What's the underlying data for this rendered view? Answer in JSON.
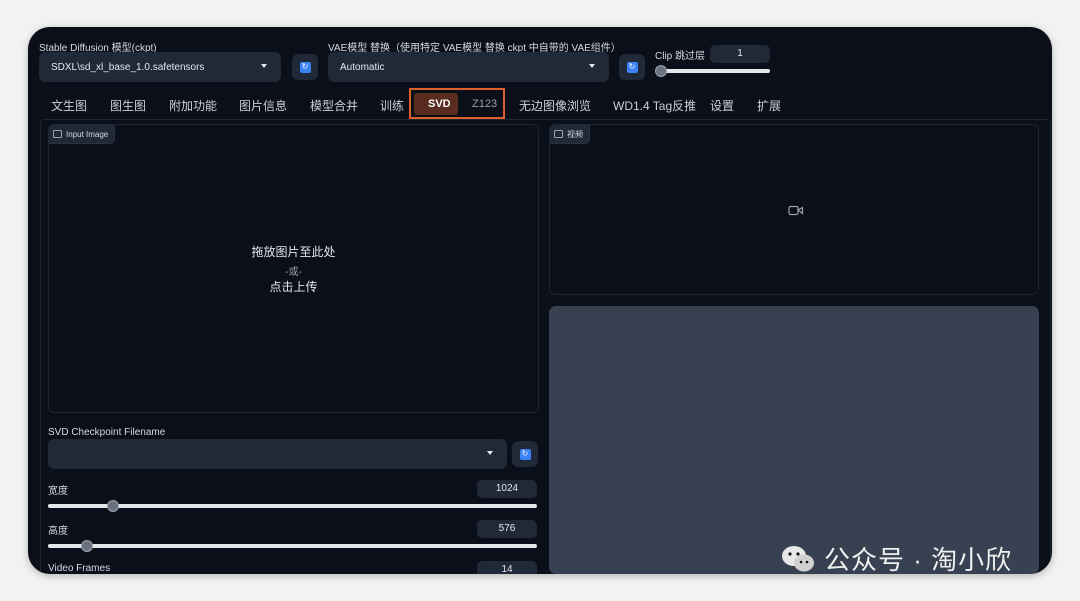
{
  "model": {
    "label": "Stable Diffusion 模型(ckpt)",
    "value": "SDXL\\sd_xl_base_1.0.safetensors"
  },
  "vae": {
    "label": "VAE模型 替换（使用特定 VAE模型 替换 ckpt 中自带的 VAE组件）",
    "value": "Automatic"
  },
  "clip": {
    "label": "Clip 跳过层",
    "value": "1"
  },
  "tabs": [
    {
      "label": "文生图"
    },
    {
      "label": "图生图"
    },
    {
      "label": "附加功能"
    },
    {
      "label": "图片信息"
    },
    {
      "label": "模型合并"
    },
    {
      "label": "训练"
    },
    {
      "label": "SVD"
    },
    {
      "label": "Z123"
    },
    {
      "label": "无边图像浏览"
    },
    {
      "label": "WD1.4 Tag反推"
    },
    {
      "label": "设置"
    },
    {
      "label": "扩展"
    }
  ],
  "input_image": {
    "chip": "Input Image",
    "drop_line1": "拖放图片至此处",
    "drop_line2": "-或-",
    "drop_line3": "点击上传"
  },
  "video": {
    "chip": "视频"
  },
  "svd_checkpoint": {
    "label": "SVD Checkpoint Filename",
    "value": ""
  },
  "width": {
    "label": "宽度",
    "value": "1024",
    "fraction": 0.11
  },
  "height": {
    "label": "高度",
    "value": "576",
    "fraction": 0.06
  },
  "frames": {
    "label": "Video Frames",
    "value": "14"
  },
  "watermark": "公众号 · 淘小欣",
  "colors": {
    "highlight_border": "#e0602b",
    "accent": "#3b82f6",
    "background": "#0b0f19"
  }
}
